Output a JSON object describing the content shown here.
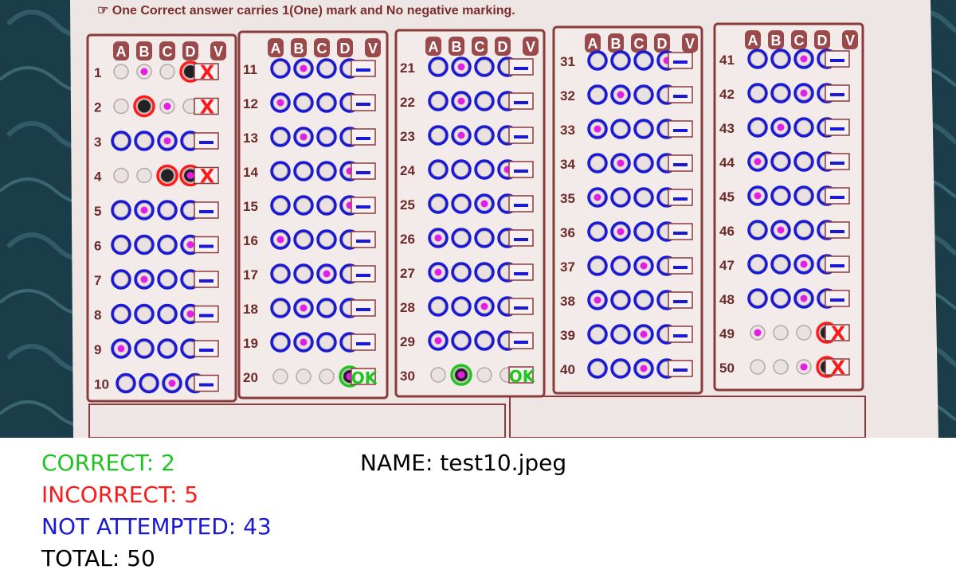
{
  "sheet": {
    "instruction": "☞ One Correct answer carries 1(One) mark and No negative marking.",
    "column_header_letters": [
      "A",
      "B",
      "C",
      "D",
      "V"
    ],
    "questions": [
      {
        "n": "1",
        "state": "incorrect",
        "mark": 1,
        "circled": [
          3
        ],
        "verdict": "X"
      },
      {
        "n": "2",
        "state": "incorrect",
        "mark": 2,
        "circled": [
          1
        ],
        "verdict": "X"
      },
      {
        "n": "3",
        "state": "not_attempted",
        "mark": 2,
        "verdict": "–"
      },
      {
        "n": "4",
        "state": "incorrect",
        "mark": 3,
        "circled": [
          2,
          3
        ],
        "verdict": "X"
      },
      {
        "n": "5",
        "state": "not_attempted",
        "mark": 1,
        "verdict": "–"
      },
      {
        "n": "6",
        "state": "not_attempted",
        "mark": 3,
        "verdict": "–"
      },
      {
        "n": "7",
        "state": "not_attempted",
        "mark": 1,
        "verdict": "–"
      },
      {
        "n": "8",
        "state": "not_attempted",
        "mark": 3,
        "verdict": "–"
      },
      {
        "n": "9",
        "state": "not_attempted",
        "mark": 0,
        "verdict": "–"
      },
      {
        "n": "10",
        "state": "not_attempted",
        "mark": 2,
        "verdict": "–"
      },
      {
        "n": "11",
        "state": "not_attempted",
        "mark": 1,
        "verdict": "–"
      },
      {
        "n": "12",
        "state": "not_attempted",
        "mark": 0,
        "verdict": "–"
      },
      {
        "n": "13",
        "state": "not_attempted",
        "mark": 1,
        "verdict": "–"
      },
      {
        "n": "14",
        "state": "not_attempted",
        "mark": 3,
        "verdict": "–"
      },
      {
        "n": "15",
        "state": "not_attempted",
        "mark": 3,
        "verdict": "–"
      },
      {
        "n": "16",
        "state": "not_attempted",
        "mark": 0,
        "verdict": "–"
      },
      {
        "n": "17",
        "state": "not_attempted",
        "mark": 2,
        "verdict": "–"
      },
      {
        "n": "18",
        "state": "not_attempted",
        "mark": 1,
        "verdict": "–"
      },
      {
        "n": "19",
        "state": "not_attempted",
        "mark": 1,
        "verdict": "–"
      },
      {
        "n": "20",
        "state": "correct",
        "mark": 3,
        "circled": [
          3
        ],
        "verdict": "OK"
      },
      {
        "n": "21",
        "state": "not_attempted",
        "mark": 1,
        "verdict": "–"
      },
      {
        "n": "22",
        "state": "not_attempted",
        "mark": 1,
        "verdict": "–"
      },
      {
        "n": "23",
        "state": "not_attempted",
        "mark": 1,
        "verdict": "–"
      },
      {
        "n": "24",
        "state": "not_attempted",
        "mark": 3,
        "verdict": "–"
      },
      {
        "n": "25",
        "state": "not_attempted",
        "mark": 2,
        "verdict": "–"
      },
      {
        "n": "26",
        "state": "not_attempted",
        "mark": 0,
        "verdict": "–"
      },
      {
        "n": "27",
        "state": "not_attempted",
        "mark": 0,
        "verdict": "–"
      },
      {
        "n": "28",
        "state": "not_attempted",
        "mark": 2,
        "verdict": "–"
      },
      {
        "n": "29",
        "state": "not_attempted",
        "mark": 0,
        "verdict": "–"
      },
      {
        "n": "30",
        "state": "correct",
        "mark": 1,
        "circled": [
          1
        ],
        "verdict": "OK"
      },
      {
        "n": "31",
        "state": "not_attempted",
        "mark": 3,
        "verdict": "–"
      },
      {
        "n": "32",
        "state": "not_attempted",
        "mark": 1,
        "verdict": "–"
      },
      {
        "n": "33",
        "state": "not_attempted",
        "mark": 0,
        "verdict": "–"
      },
      {
        "n": "34",
        "state": "not_attempted",
        "mark": 1,
        "verdict": "–"
      },
      {
        "n": "35",
        "state": "not_attempted",
        "mark": 0,
        "verdict": "–"
      },
      {
        "n": "36",
        "state": "not_attempted",
        "mark": 1,
        "verdict": "–"
      },
      {
        "n": "37",
        "state": "not_attempted",
        "mark": 2,
        "verdict": "–"
      },
      {
        "n": "38",
        "state": "not_attempted",
        "mark": 0,
        "verdict": "–"
      },
      {
        "n": "39",
        "state": "not_attempted",
        "mark": 2,
        "verdict": "–"
      },
      {
        "n": "40",
        "state": "not_attempted",
        "mark": 2,
        "verdict": "–"
      },
      {
        "n": "41",
        "state": "not_attempted",
        "mark": 2,
        "verdict": "–"
      },
      {
        "n": "42",
        "state": "not_attempted",
        "mark": 2,
        "verdict": "–"
      },
      {
        "n": "43",
        "state": "not_attempted",
        "mark": 1,
        "verdict": "–"
      },
      {
        "n": "44",
        "state": "not_attempted",
        "mark": 0,
        "verdict": "–"
      },
      {
        "n": "45",
        "state": "not_attempted",
        "mark": 0,
        "verdict": "–"
      },
      {
        "n": "46",
        "state": "not_attempted",
        "mark": 1,
        "verdict": "–"
      },
      {
        "n": "47",
        "state": "not_attempted",
        "mark": 2,
        "verdict": "–"
      },
      {
        "n": "48",
        "state": "not_attempted",
        "mark": 2,
        "verdict": "–"
      },
      {
        "n": "49",
        "state": "incorrect",
        "mark": 0,
        "circled": [
          3
        ],
        "verdict": "X"
      },
      {
        "n": "50",
        "state": "incorrect",
        "mark": 2,
        "circled": [
          3
        ],
        "verdict": "X"
      }
    ]
  },
  "results": {
    "correct": "CORRECT: 2",
    "incorrect": "INCORRECT: 5",
    "not_attempted": "NOT ATTEMPTED: 43",
    "total": "TOTAL: 50",
    "name": "NAME: test10.jpeg"
  },
  "colors": {
    "correct": "#1fc51f",
    "incorrect": "#ff1a1a",
    "not_attempted": "#1a1ad6",
    "total": "#000000",
    "detected_mark": "#e41ee4",
    "sheet_maroon": "#8c3b3b",
    "sheet_paper": "#efe7e6",
    "background_fabric": "#1b3d4a"
  }
}
